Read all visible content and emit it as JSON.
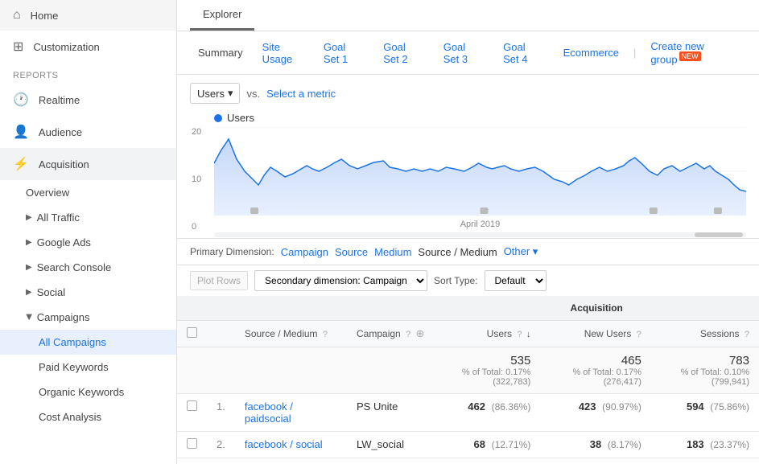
{
  "sidebar": {
    "nav_items": [
      {
        "id": "home",
        "label": "Home",
        "icon": "⌂"
      },
      {
        "id": "customization",
        "label": "Customization",
        "icon": "⊞"
      }
    ],
    "reports_label": "REPORTS",
    "report_items": [
      {
        "id": "realtime",
        "label": "Realtime",
        "icon": "🕐",
        "type": "top"
      },
      {
        "id": "audience",
        "label": "Audience",
        "icon": "👤",
        "type": "top"
      },
      {
        "id": "acquisition",
        "label": "Acquisition",
        "icon": "⚡",
        "type": "top",
        "active": true
      }
    ],
    "acquisition_subitems": [
      {
        "id": "overview",
        "label": "Overview"
      },
      {
        "id": "all-traffic",
        "label": "All Traffic",
        "hasArrow": true
      },
      {
        "id": "google-ads",
        "label": "Google Ads",
        "hasArrow": true
      },
      {
        "id": "search-console",
        "label": "Search Console",
        "hasArrow": true
      },
      {
        "id": "social",
        "label": "Social",
        "hasArrow": true
      },
      {
        "id": "campaigns",
        "label": "Campaigns",
        "hasArrow": true,
        "open": true
      }
    ],
    "campaigns_subitems": [
      {
        "id": "all-campaigns",
        "label": "All Campaigns",
        "active": true
      },
      {
        "id": "paid-keywords",
        "label": "Paid Keywords"
      },
      {
        "id": "organic-keywords",
        "label": "Organic Keywords"
      },
      {
        "id": "cost-analysis",
        "label": "Cost Analysis"
      }
    ]
  },
  "explorer_tab": "Explorer",
  "sub_tabs": [
    {
      "id": "summary",
      "label": "Summary",
      "active": true
    },
    {
      "id": "site-usage",
      "label": "Site Usage"
    },
    {
      "id": "goal-set-1",
      "label": "Goal Set 1"
    },
    {
      "id": "goal-set-2",
      "label": "Goal Set 2"
    },
    {
      "id": "goal-set-3",
      "label": "Goal Set 3"
    },
    {
      "id": "goal-set-4",
      "label": "Goal Set 4"
    },
    {
      "id": "ecommerce",
      "label": "Ecommerce"
    },
    {
      "id": "create-new-group",
      "label": "Create new group",
      "badge": "NEW"
    }
  ],
  "metric": {
    "selected": "Users",
    "vs_label": "vs.",
    "select_metric_label": "Select a metric"
  },
  "chart": {
    "legend_label": "Users",
    "y_max": "20",
    "y_mid": "10",
    "x_label": "April 2019"
  },
  "primary_dimension": {
    "label": "Primary Dimension:",
    "options": [
      {
        "id": "campaign",
        "label": "Campaign"
      },
      {
        "id": "source",
        "label": "Source"
      },
      {
        "id": "medium",
        "label": "Medium"
      },
      {
        "id": "source-medium",
        "label": "Source / Medium",
        "active": true
      },
      {
        "id": "other",
        "label": "Other ▾"
      }
    ]
  },
  "table_controls": {
    "plot_rows_label": "Plot Rows",
    "secondary_dim_label": "Secondary dimension: Campaign",
    "sort_type_label": "Sort Type:",
    "sort_default_label": "Default"
  },
  "table": {
    "group_header": "Acquisition",
    "columns": [
      {
        "id": "source-medium",
        "label": "Source / Medium"
      },
      {
        "id": "campaign",
        "label": "Campaign"
      },
      {
        "id": "users",
        "label": "Users",
        "sort": true
      },
      {
        "id": "new-users",
        "label": "New Users"
      },
      {
        "id": "sessions",
        "label": "Sessions"
      }
    ],
    "total_row": {
      "users": "535",
      "users_sub": "% of Total: 0.17% (322,783)",
      "new_users": "465",
      "new_users_sub": "% of Total: 0.17% (276,417)",
      "sessions": "783",
      "sessions_sub": "% of Total: 0.10% (799,941)"
    },
    "rows": [
      {
        "num": "1.",
        "source_medium": "facebook / paidsocial",
        "campaign": "PS Unite",
        "users": "462",
        "users_pct": "(86.36%)",
        "new_users": "423",
        "new_users_pct": "(90.97%)",
        "sessions": "594",
        "sessions_pct": "(75.86%)"
      },
      {
        "num": "2.",
        "source_medium": "facebook / social",
        "campaign": "LW_social",
        "users": "68",
        "users_pct": "(12.71%)",
        "new_users": "38",
        "new_users_pct": "(8.17%)",
        "sessions": "183",
        "sessions_pct": "(23.37%)"
      }
    ]
  }
}
